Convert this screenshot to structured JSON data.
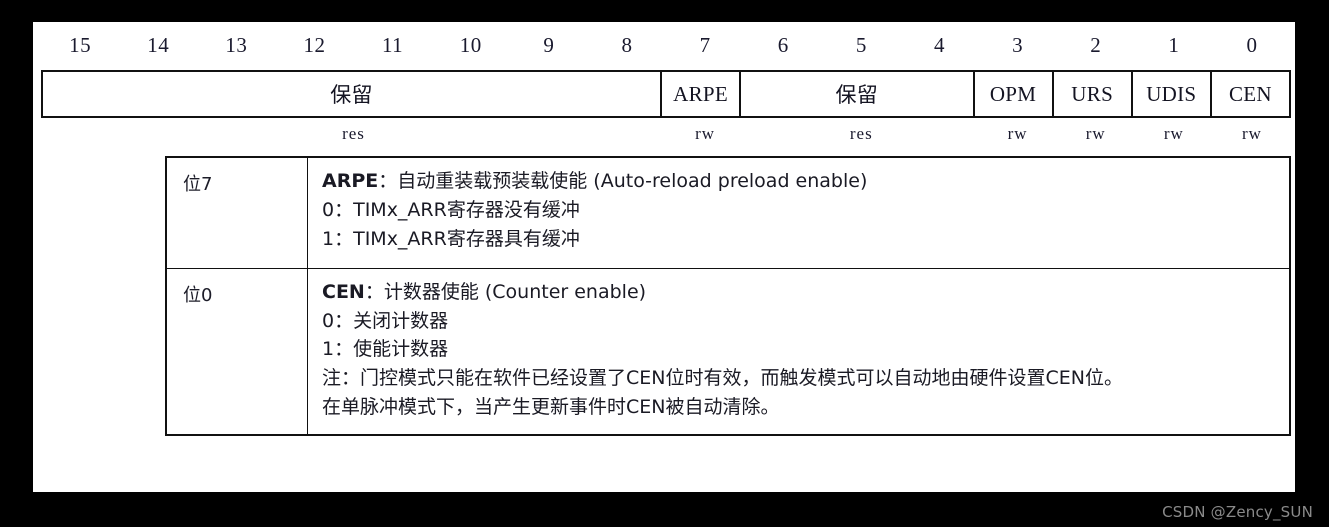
{
  "register_table": {
    "bit_numbers": [
      "15",
      "14",
      "13",
      "12",
      "11",
      "10",
      "9",
      "8",
      "7",
      "6",
      "5",
      "4",
      "3",
      "2",
      "1",
      "0"
    ],
    "fields": [
      {
        "label": "保留",
        "span": 8,
        "access": "res",
        "is_cn": true
      },
      {
        "label": "ARPE",
        "span": 1,
        "access": "rw",
        "is_cn": false
      },
      {
        "label": "保留",
        "span": 3,
        "access": "res",
        "is_cn": true
      },
      {
        "label": "OPM",
        "span": 1,
        "access": "rw",
        "is_cn": false
      },
      {
        "label": "URS",
        "span": 1,
        "access": "rw",
        "is_cn": false
      },
      {
        "label": "UDIS",
        "span": 1,
        "access": "rw",
        "is_cn": false
      },
      {
        "label": "CEN",
        "span": 1,
        "access": "rw",
        "is_cn": false
      }
    ]
  },
  "descriptions": [
    {
      "bit": "位7",
      "name": "ARPE",
      "title_rest": "：自动重装载预装载使能 (Auto-reload preload enable)",
      "lines": [
        "0：TIMx_ARR寄存器没有缓冲",
        "1：TIMx_ARR寄存器具有缓冲"
      ]
    },
    {
      "bit": "位0",
      "name": "CEN",
      "title_rest": "：计数器使能 (Counter enable)",
      "lines": [
        "0：关闭计数器",
        "1：使能计数器",
        "注：门控模式只能在软件已经设置了CEN位时有效，而触发模式可以自动地由硬件设置CEN位。",
        "在单脉冲模式下，当产生更新事件时CEN被自动清除。"
      ]
    }
  ],
  "watermark": "CSDN @Zency_SUN"
}
